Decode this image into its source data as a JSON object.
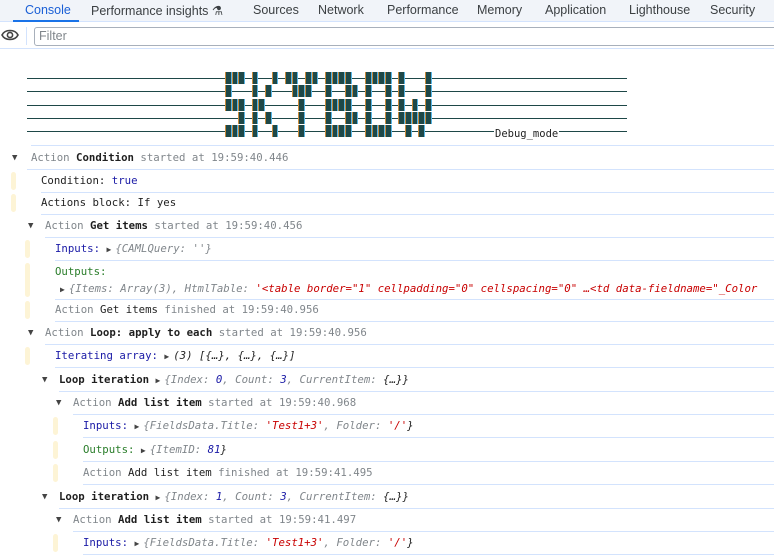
{
  "tabs": [
    "Console",
    "Performance insights",
    "Sources",
    "Network",
    "Performance",
    "Memory",
    "Application",
    "Lighthouse",
    "Security"
  ],
  "active_tab": "Console",
  "filter": {
    "placeholder": "Filter"
  },
  "banner": {
    "label": "Debug_mode"
  },
  "log": {
    "action": "Action",
    "started": "started at",
    "finished": "finished at",
    "condition": {
      "name": "Condition",
      "time": "19:59:40.446",
      "cond_label": "Condition:",
      "cond_value": "true",
      "block": "Actions block: If yes"
    },
    "get_items": {
      "name": "Get items",
      "start": "19:59:40.456",
      "end": "19:59:40.956",
      "inputs_label": "Inputs:",
      "inputs": "{CAMLQuery: ''}",
      "outputs_label": "Outputs:",
      "outputs_pre": "{Items: Array(3), HtmlTable: ",
      "outputs_str": "'<table border=\"1\" cellpadding=\"0\" cellspacing=\"0\" …<td data-fieldname=\"_Color"
    },
    "loop": {
      "name": "Loop: apply to each",
      "start": "19:59:40.956",
      "iter_label": "Iterating array:",
      "iter_value": "(3) [{…}, {…}, {…}]"
    },
    "iterations": [
      {
        "label": "Loop iteration",
        "index": "0",
        "count": "3",
        "action": "Add list item",
        "start": "19:59:40.968",
        "end": "19:59:41.495",
        "title": "'Test1+3'",
        "folder": "'/'",
        "item_id": "81"
      },
      {
        "label": "Loop iteration",
        "index": "1",
        "count": "3",
        "action": "Add list item",
        "start": "19:59:41.497",
        "title": "'Test1+3'",
        "folder": "'/'"
      }
    ],
    "inputs_label": "Inputs:",
    "outputs_label": "Outputs:"
  }
}
